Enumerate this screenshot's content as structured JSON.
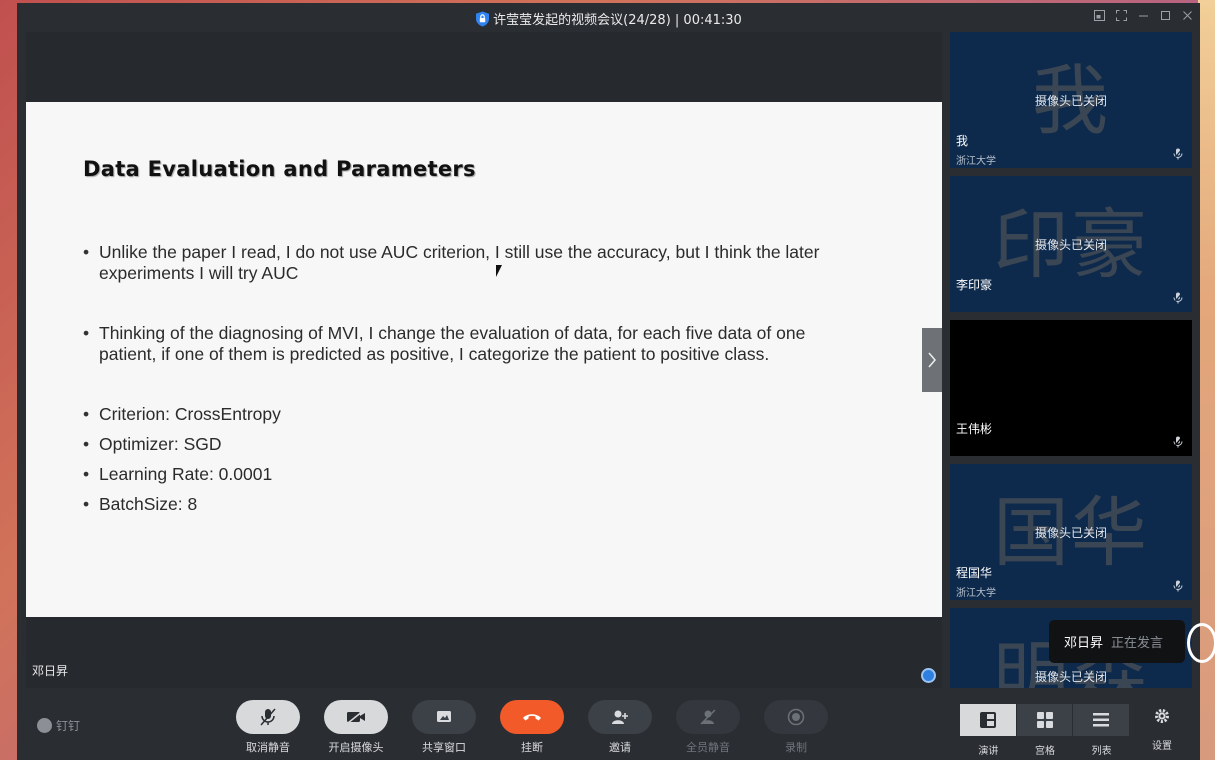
{
  "window": {
    "title": "许莹莹发起的视频会议(24/28) | 00:41:30"
  },
  "slide": {
    "title": "Data Evaluation and Parameters",
    "bullets": [
      "Unlike the paper I read, I do not use AUC criterion, I still use the accuracy, but I think the later experiments I will try AUC",
      "Thinking of the diagnosing of MVI, I change the evaluation of data, for each five data of one patient, if one of them is predicted as positive, I categorize the patient to positive class.",
      "Criterion: CrossEntropy",
      "Optimizer: SGD",
      "Learning Rate: 0.0001",
      "BatchSize: 8"
    ]
  },
  "stage": {
    "speaker_name": "邓日昇"
  },
  "participants": [
    {
      "avatar_text": "我",
      "camera_status": "摄像头已关闭",
      "name": "我",
      "org": "浙江大学",
      "background": "#0d2a4d"
    },
    {
      "avatar_text": "印豪",
      "camera_status": "摄像头已关闭",
      "name": "李印豪",
      "org": "",
      "background": "#0d2a4d"
    },
    {
      "avatar_text": "",
      "camera_status": "",
      "name": "王伟彬",
      "org": "",
      "background": "#000000"
    },
    {
      "avatar_text": "国华",
      "camera_status": "摄像头已关闭",
      "name": "程国华",
      "org": "浙江大学",
      "background": "#0d2a4d"
    },
    {
      "avatar_text": "明森",
      "camera_status": "摄像头已关闭",
      "name": "",
      "org": "",
      "background": "#0d2a4d"
    }
  ],
  "speaking_indicator": {
    "name": "邓日昇",
    "status": "正在发言"
  },
  "toolbar": {
    "brand": "钉钉",
    "unmute": "取消静音",
    "camera_on": "开启摄像头",
    "share_window": "共享窗口",
    "hang_up": "挂断",
    "invite": "邀请",
    "mute_all": "全员静音",
    "record": "录制",
    "view_presenter": "演讲",
    "view_grid": "宫格",
    "view_list": "列表",
    "settings": "设置"
  },
  "colors": {
    "hangup": "#f25a29",
    "tile_bg": "#0d2a4d",
    "window_bg": "#2a2d32"
  }
}
